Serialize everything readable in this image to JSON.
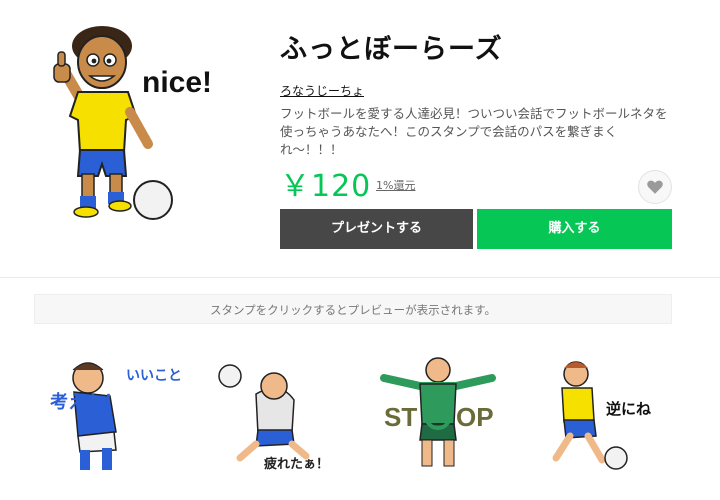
{
  "product": {
    "title": "ふっとぼーらーズ",
    "author": "ろなうじーちょ",
    "description": "フットボールを愛する人達必見！ついつい会話でフットボールネタを使っちゃうあなたへ！このスタンプで会話のパスを繋ぎまくれ〜！！！",
    "price": "￥120",
    "point_link": "1%還元",
    "main_image_text": "nice!"
  },
  "actions": {
    "present_label": "プレゼントする",
    "buy_label": "購入する",
    "favorite_icon": "heart-icon"
  },
  "notice": "スタンプをクリックするとプレビューが表示されます。",
  "stickers": [
    {
      "caption_line1": "いいこと",
      "caption_line2": "考えた！"
    },
    {
      "caption": "疲れたぁ！"
    },
    {
      "caption_left": "ST",
      "caption_right": "OP"
    },
    {
      "caption": "逆にね"
    }
  ],
  "colors": {
    "accent_green": "#06c755",
    "present_button": "#474747",
    "jersey_yellow": "#f6e000",
    "shorts_blue": "#2b5fd6",
    "keeper_green": "#2e9a5c"
  }
}
